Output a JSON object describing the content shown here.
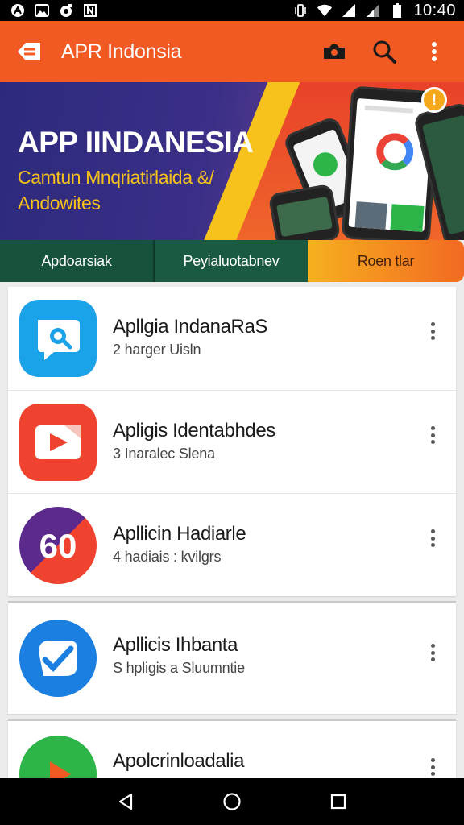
{
  "status_bar": {
    "left_icons": [
      "app-notification-icon",
      "image-notification-icon",
      "camera-notification-icon",
      "n-notification-icon"
    ],
    "right_icons": [
      "vibrate-icon",
      "wifi-icon",
      "signal-icon",
      "signal-icon",
      "battery-icon"
    ],
    "time": "10:40"
  },
  "app_bar": {
    "title": "APR Indonsia",
    "background": "#f15a22",
    "actions": [
      "camera-icon",
      "search-icon",
      "more-vert-icon"
    ]
  },
  "banner": {
    "title": "APP IINDANESIA",
    "subtitle": "Camtun Mnqriatirlaida &/ Andowites",
    "badge": "!"
  },
  "tabs": [
    {
      "label": "Apdoarsiak",
      "selected": false
    },
    {
      "label": "Peyialuotabnev",
      "selected": false
    },
    {
      "label": "Roen tlar",
      "selected": true
    }
  ],
  "apps": [
    {
      "name": "Apllgia IndanaRaS",
      "meta": "2 harger Uisln",
      "icon": "chat-icon",
      "color": "#1aa3e8"
    },
    {
      "name": "Apligis Identabhdes",
      "meta": "3 Inaralec Slena",
      "icon": "play-icon",
      "color": "#ef4330"
    },
    {
      "name": "Apllicin Hadiarle",
      "meta": "4 hadiais : kvilgrs",
      "icon": "60-icon",
      "color": "#5b2a8c"
    },
    {
      "name": "Apllicis Ihbanta",
      "meta": "S hpligis a Sluumntie",
      "icon": "check-icon",
      "color": "#1a7fe0"
    },
    {
      "name": "Apolcrinloadalia",
      "meta": "",
      "icon": "play-green-icon",
      "color": "#2eb54a"
    }
  ],
  "nav_bar": {
    "buttons": [
      "back-icon",
      "home-icon",
      "recents-icon"
    ]
  }
}
